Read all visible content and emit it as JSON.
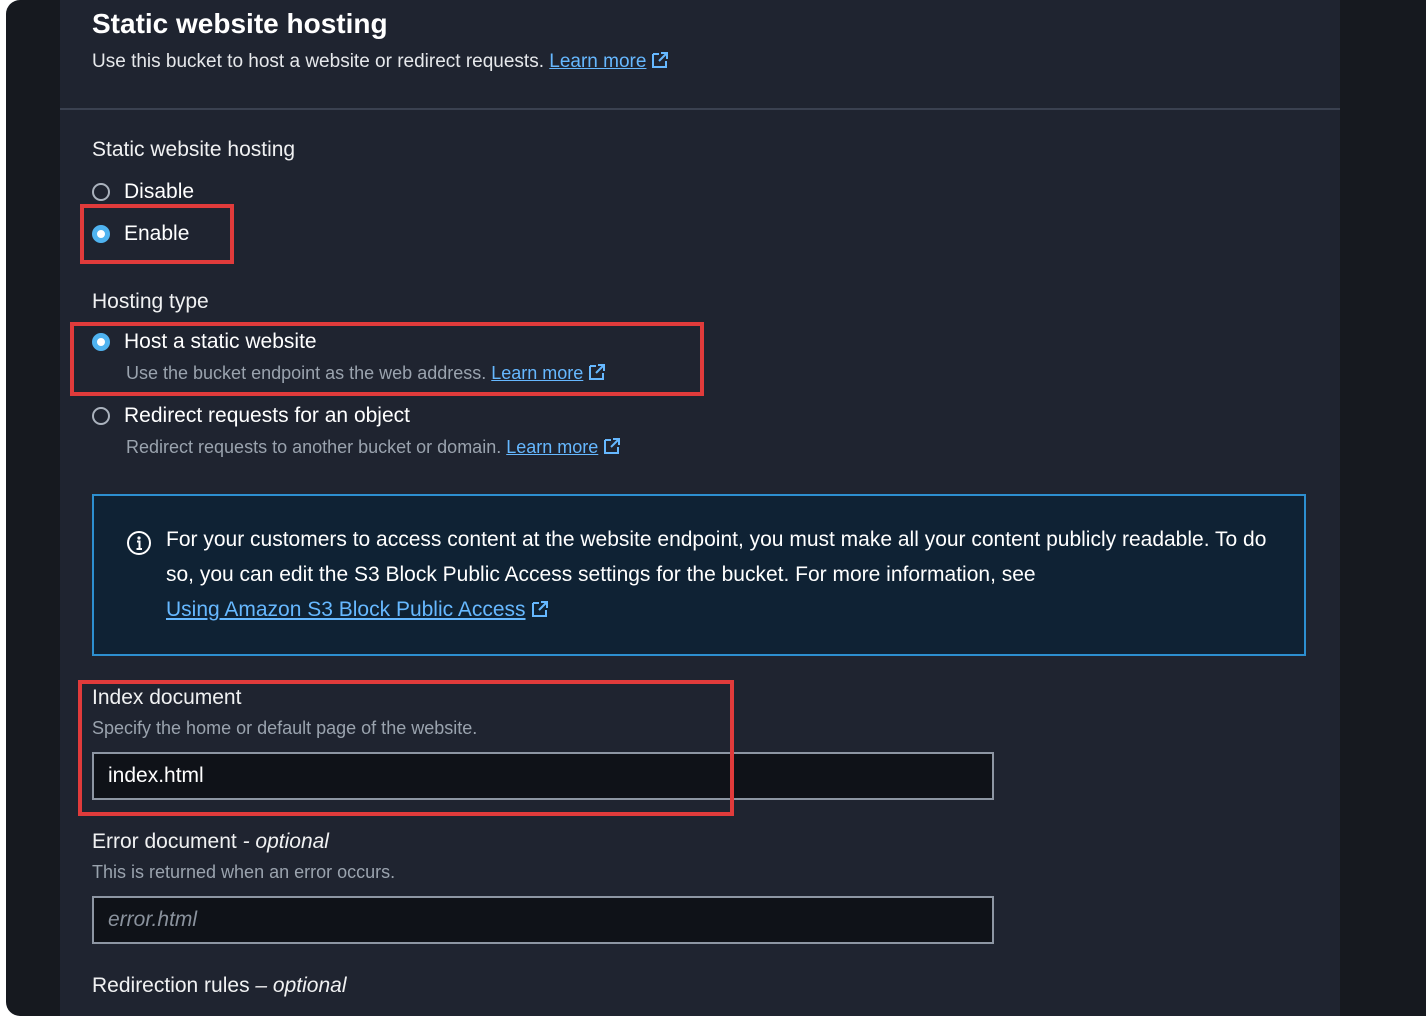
{
  "header": {
    "title": "Static website hosting",
    "description": "Use this bucket to host a website or redirect requests.",
    "learn_more": "Learn more"
  },
  "hosting_toggle": {
    "label": "Static website hosting",
    "options": [
      {
        "label": "Disable",
        "selected": false
      },
      {
        "label": "Enable",
        "selected": true
      }
    ]
  },
  "hosting_type": {
    "label": "Hosting type",
    "options": [
      {
        "label": "Host a static website",
        "description": "Use the bucket endpoint as the web address.",
        "link": "Learn more",
        "selected": true
      },
      {
        "label": "Redirect requests for an object",
        "description": "Redirect requests to another bucket or domain.",
        "link": "Learn more",
        "selected": false
      }
    ]
  },
  "info_alert": {
    "text": "For your customers to access content at the website endpoint, you must make all your content publicly readable. To do so, you can edit the S3 Block Public Access settings for the bucket. For more information, see",
    "link": "Using Amazon S3 Block Public Access"
  },
  "index_document": {
    "label": "Index document",
    "description": "Specify the home or default page of the website.",
    "value": "index.html"
  },
  "error_document": {
    "label": "Error document",
    "optional": "- optional",
    "description": "This is returned when an error occurs.",
    "placeholder": "error.html"
  },
  "redirection_rules": {
    "label": "Redirection rules",
    "optional": "– optional"
  },
  "colors": {
    "background": "#16191f",
    "panel": "#1f2430",
    "link": "#66b8ff",
    "info_border": "#2d8fd0",
    "highlight": "#e03b3b"
  }
}
